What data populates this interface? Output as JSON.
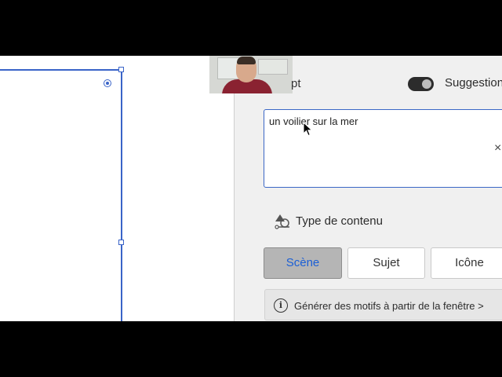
{
  "panel": {
    "prompt_label": "pt",
    "suggestions_label": "Suggestion",
    "prompt_value": "un voilier sur la mer",
    "clear_icon": "×",
    "content_type_label": "Type de contenu",
    "content_types": [
      "Scène",
      "Sujet",
      "Icône"
    ],
    "active_content_type": "Scène",
    "generate_label": "Générer des motifs à partir de la fenêtre >"
  },
  "colors": {
    "selection": "#3a64c8",
    "active_text": "#1b5fd6",
    "toggle_bg": "#2c2c2c"
  }
}
